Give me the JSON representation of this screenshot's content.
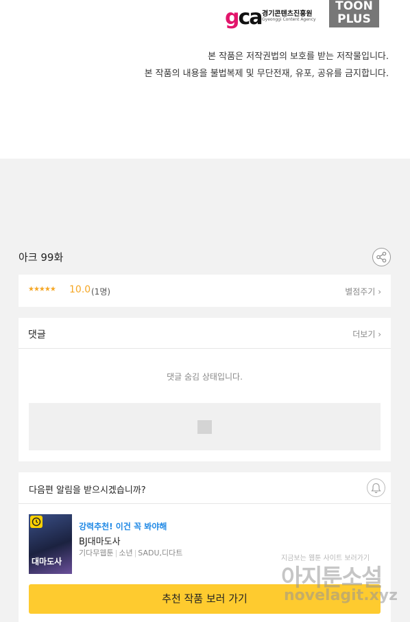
{
  "header": {
    "gca_logo": {
      "mark_g": "g",
      "mark_ca": "ca",
      "name": "경기콘텐츠진흥원",
      "sub": "Gyeonggi Content Agency"
    },
    "toon_logo": {
      "line1": "TOON",
      "line2": "PLUS"
    }
  },
  "copyright": {
    "line1": "본 작품은 저작권법의 보호를 받는 저작물입니다.",
    "line2": "본 작품의 내용을 불법복제 및 무단전재, 유포, 공유를 금지합니다."
  },
  "episode": {
    "title": "아크 99화",
    "share_icon": "share-icon"
  },
  "rating": {
    "stars": "★★★★★",
    "score": "10.0",
    "count": "(1명)",
    "rate_link": "별점주기",
    "chevron_icon": "chevron-right-icon",
    "star_color": "#f5a623"
  },
  "comments": {
    "title": "댓글",
    "more_link": "더보기",
    "hidden_message": "댓글 숨김 상태입니다.",
    "image_icon": "image-placeholder-icon"
  },
  "notify": {
    "question": "다음편 알림을 받으시겠습니까?",
    "bell_icon": "bell-icon"
  },
  "recommendation": {
    "label": "강력추천! 이건 꼭 봐야해",
    "title": "BJ대마도사",
    "genre1": "기다무웹툰",
    "genre2": "소년",
    "authors": "SADU,디다트",
    "thumb_title": "대마도사",
    "badge_icon": "clock-icon",
    "label_color": "#1e88e5"
  },
  "cta": {
    "label": "추천 작품 보러 가기",
    "color": "#fecb2f"
  },
  "watermark": {
    "top": "지금보는 웹툰 사이트 보러가기",
    "mid": "아지툰소설",
    "bot": "novelagit.xyz"
  }
}
